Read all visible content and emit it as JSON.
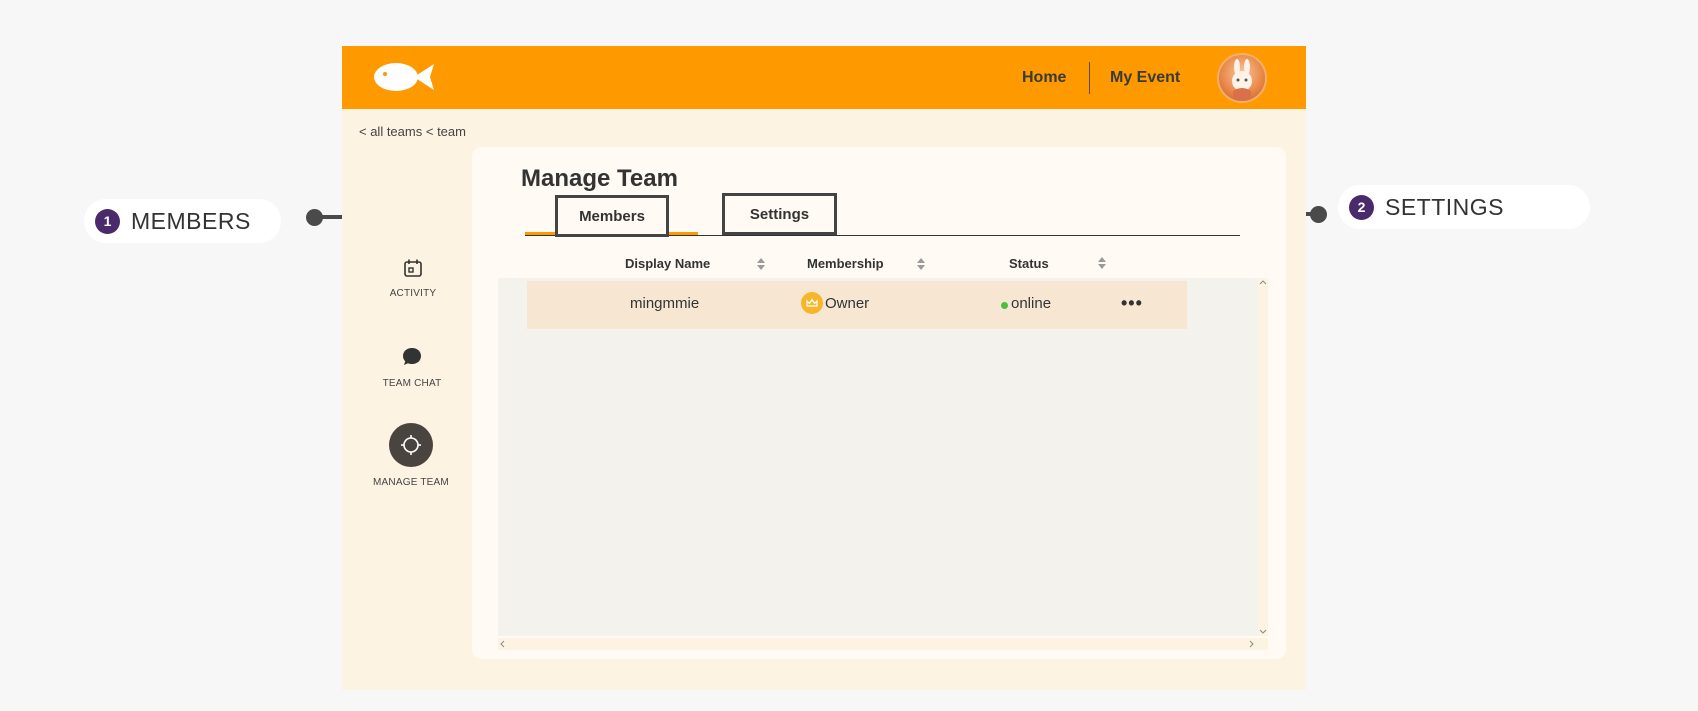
{
  "header": {
    "nav_home": "Home",
    "nav_event": "My Event"
  },
  "breadcrumb": {
    "all_teams": "< all teams",
    "team": "< team"
  },
  "sidebar": {
    "items": [
      {
        "label": "ACTIVITY",
        "icon": "calendar-icon"
      },
      {
        "label": "TEAM CHAT",
        "icon": "chat-bubble-icon"
      },
      {
        "label": "MANAGE TEAM",
        "icon": "gear-icon"
      }
    ]
  },
  "main": {
    "title": "Manage Team",
    "tabs": [
      {
        "label": "Members",
        "active": true
      },
      {
        "label": "Settings",
        "active": false
      }
    ],
    "table": {
      "columns": [
        "Display Name",
        "Membership",
        "Status"
      ],
      "rows": [
        {
          "display_name": "mingmmie",
          "membership": "Owner",
          "status": "online",
          "actions": "•••"
        }
      ]
    }
  },
  "callouts": [
    {
      "number": "1",
      "label": "MEMBERS"
    },
    {
      "number": "2",
      "label": "SETTINGS"
    }
  ],
  "colors": {
    "brand": "#ff9900",
    "callout_badge": "#4a2a6a",
    "status_online": "#4bbf3a",
    "owner_badge": "#f7b62a"
  }
}
